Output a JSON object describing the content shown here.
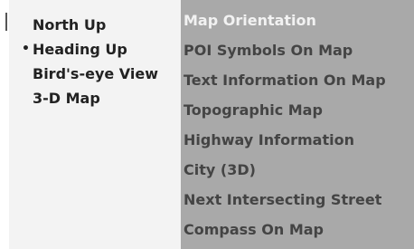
{
  "left_menu": {
    "items": [
      {
        "label": "North Up",
        "selected": false
      },
      {
        "label": "Heading Up",
        "selected": true,
        "marker": "•"
      },
      {
        "label": "Bird's-eye View",
        "selected": false
      },
      {
        "label": "3-D Map",
        "selected": false
      }
    ]
  },
  "right_menu": {
    "heading": "Map Orientation",
    "items": [
      "POI Symbols On Map",
      "Text Information On Map",
      "Topographic Map",
      "Highway Information",
      "City (3D)",
      "Next Intersecting Street",
      "Compass On Map"
    ]
  },
  "colors": {
    "left_background": "#f3f3f3",
    "right_background": "#a9a9a9",
    "heading_text": "#f2f2f2",
    "item_text": "#444444"
  }
}
